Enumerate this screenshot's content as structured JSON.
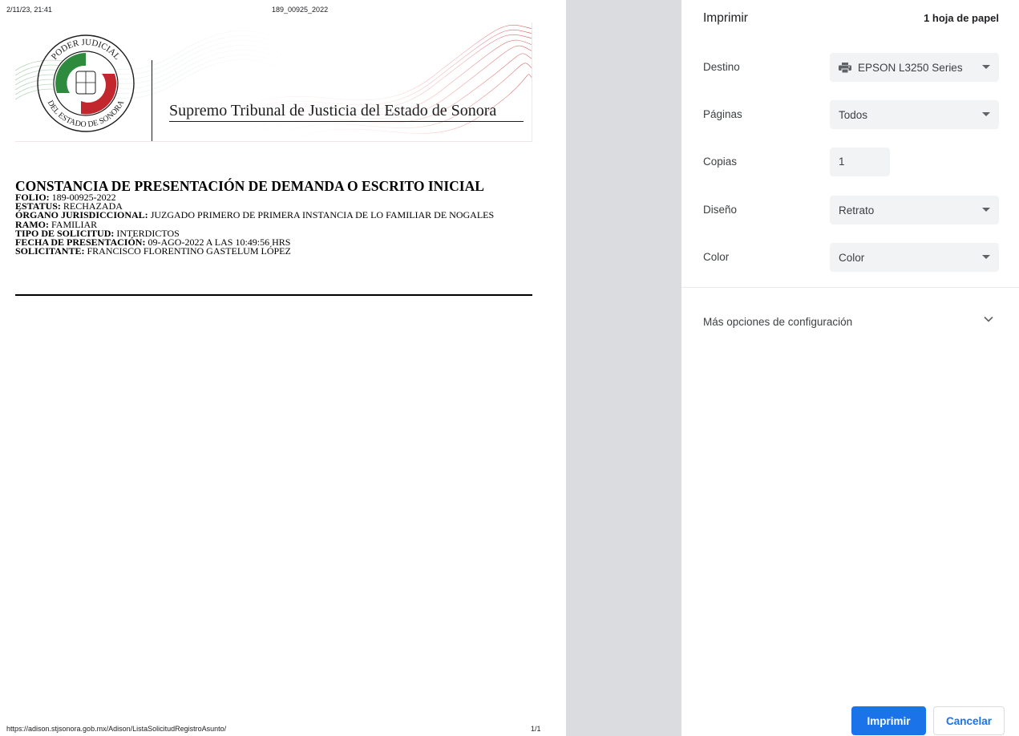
{
  "preview": {
    "header_left": "2/11/23, 21:41",
    "header_center": "189_00925_2022",
    "footer_left": "https://adison.stjsonora.gob.mx/Adison/ListaSolicitudRegistroAsunto/",
    "footer_right": "1/1",
    "banner": {
      "seal_top_text": "PODER JUDICIAL",
      "seal_bottom_text": "DEL ESTADO DE SONORA",
      "title": "Supremo Tribunal de Justicia del Estado de Sonora"
    },
    "document": {
      "heading": "CONSTANCIA DE PRESENTACIÓN DE DEMANDA O ESCRITO INICIAL",
      "fields": [
        {
          "label": "FOLIO:",
          "value": "189-00925-2022"
        },
        {
          "label": "ESTATUS:",
          "value": "RECHAZADA"
        },
        {
          "label": "ÓRGANO JURISDICCIONAL:",
          "value": "JUZGADO PRIMERO DE PRIMERA INSTANCIA DE LO FAMILIAR DE NOGALES"
        },
        {
          "label": "RAMO:",
          "value": "FAMILIAR"
        },
        {
          "label": "TIPO DE SOLICITUD:",
          "value": "INTERDICTOS"
        },
        {
          "label": "FECHA DE PRESENTACIÓN:",
          "value": "09-AGO-2022 A LAS 10:49:56 HRS"
        },
        {
          "label": "SOLICITANTE:",
          "value": "FRANCISCO FLORENTINO GASTELUM LÓPEZ"
        }
      ]
    }
  },
  "panel": {
    "title": "Imprimir",
    "sheet_count": "1 hoja de papel",
    "settings": {
      "destination": {
        "label": "Destino",
        "value": "EPSON L3250 Series",
        "icon": "printer-icon"
      },
      "pages": {
        "label": "Páginas",
        "value": "Todos"
      },
      "copies": {
        "label": "Copias",
        "value": "1"
      },
      "layout": {
        "label": "Diseño",
        "value": "Retrato"
      },
      "color": {
        "label": "Color",
        "value": "Color"
      }
    },
    "more_options": {
      "label": "Más opciones de configuración",
      "icon": "chevron-down-icon"
    },
    "buttons": {
      "print": "Imprimir",
      "cancel": "Cancelar"
    }
  },
  "colors": {
    "accent": "#1a73e8",
    "gutter": "#dadce0",
    "select_bg": "#f1f3f4",
    "seal_green": "#2e8b3e",
    "seal_red": "#c1272d"
  }
}
